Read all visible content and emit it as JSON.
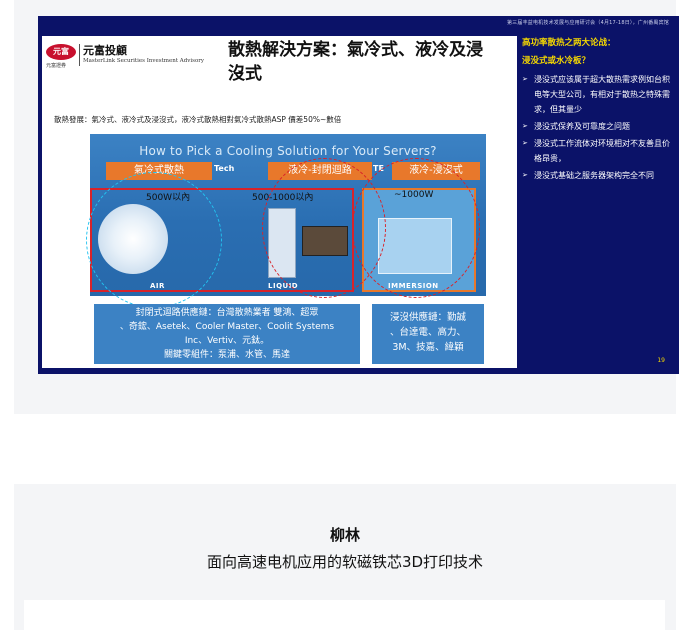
{
  "slide": {
    "header": "第三届丰益电机技术发展与应用研讨会（4月17-18日），广州番禺宾馆",
    "page_number": "19",
    "logo": {
      "badge_text": "元富",
      "badge_sub": "元富證券",
      "name_zh": "元富投顧",
      "name_en": "MasterLink Securities Investment Advisory"
    },
    "title": "散熱解決方案：氣冷式、液冷及浸沒式",
    "subtitle": "散熱發展：氣冷式、液冷式及浸沒式，液冷式散熱相對氣冷式散熱ASP 價差50%~數倍",
    "panel": {
      "title": "How to Pick a Cooling Solution for Your Servers?",
      "tech_left": "Tech",
      "tech_right": "TE",
      "tags": [
        "氣冷式散熱",
        "液冷-封閉迴路",
        "液冷-浸沒式"
      ],
      "powers": [
        "500W以內",
        "500-1000以內",
        "~1000W"
      ],
      "labels": [
        "AIR",
        "LIQUID",
        "IMMERSION"
      ]
    },
    "supply_left": [
      "封閉式迴路供應鏈：台灣散熱業者 雙鴻、超眾",
      "、奇鋐、Asetek、Cooler Master、Coolit Systems",
      "Inc、Vertiv、元鈦。",
      "關鍵零組件：泵浦、水管、馬達"
    ],
    "supply_right": [
      "浸沒供應鏈：勤誠",
      "、台達電、高力、",
      "3M、技嘉、緯穎"
    ],
    "right_panel": {
      "question_1": "高功率散热之两大论战：",
      "question_2": "浸没式或水冷板？",
      "bullets": [
        "浸没式应该属于超大散热需求例如台积电等大型公司，有相对于散热之特殊需求，但其量少",
        "浸没式保养及可靠度之问题",
        "浸没式工作流体对环境相对不友善且价格昂贵，",
        "浸没式基础之服务器架构完全不同"
      ]
    }
  },
  "speaker": {
    "name": "柳林",
    "topic": "面向高速电机应用的软磁铁芯3D打印技术"
  }
}
